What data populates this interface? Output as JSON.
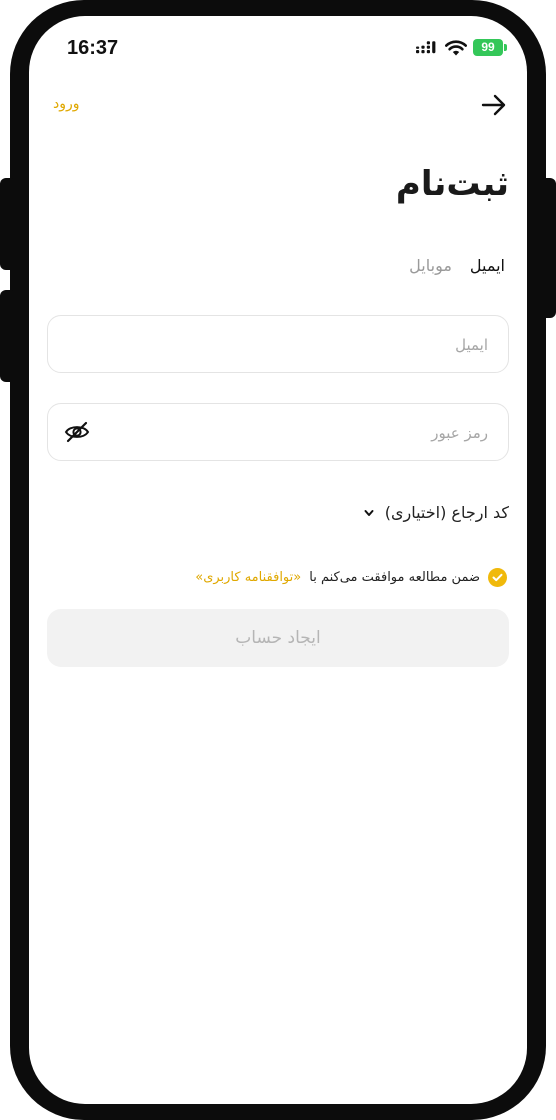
{
  "status_bar": {
    "time": "16:37",
    "battery": "99"
  },
  "header": {
    "login_link": "ورود",
    "back_icon": "arrow-right-icon"
  },
  "title": "ثبت‌نام",
  "tabs": [
    {
      "label": "ایمیل",
      "active": true
    },
    {
      "label": "موبایل",
      "active": false
    }
  ],
  "form": {
    "email_placeholder": "ایمیل",
    "password_placeholder": "رمز عبور",
    "referral_label": "کد ارجاع (اختیاری)"
  },
  "agreement": {
    "checked": true,
    "text": "ضمن مطالعه موافقت می‌کنم با",
    "link": "«توافقنامه کاربری»"
  },
  "submit_label": "ایجاد حساب",
  "colors": {
    "accent": "#f0b90b",
    "link": "#e0a800",
    "battery": "#34c759",
    "button_disabled_bg": "#f2f2f2"
  }
}
